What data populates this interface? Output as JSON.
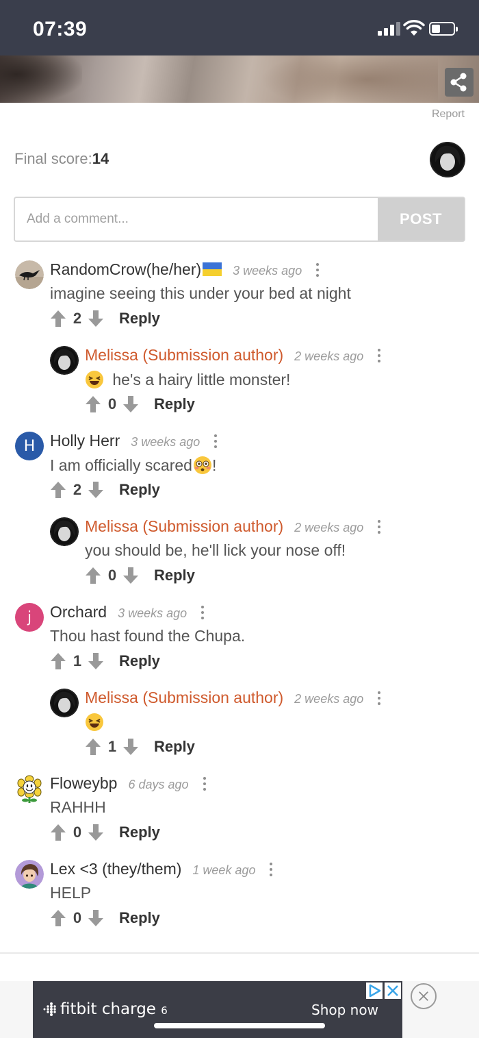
{
  "status_bar": {
    "time": "07:39"
  },
  "post": {
    "report_label": "Report",
    "final_score_label": "Final score:",
    "final_score_value": "14",
    "comment_placeholder": "Add a comment...",
    "post_button_label": "POST"
  },
  "comments": [
    {
      "name": "RandomCrow(he/her)",
      "name_flag": "ukraine-flag-icon",
      "time": "3 weeks ago",
      "text": "imagine seeing this under your bed at night",
      "votes": "2",
      "reply_label": "Reply",
      "avatar": "crow-avatar-icon"
    },
    {
      "name": "Melissa (Submission author)",
      "time": "2 weeks ago",
      "emoji": "laughing-face-icon",
      "text": "he's a hairy little monster!",
      "votes": "0",
      "reply_label": "Reply",
      "is_author": true
    },
    {
      "name": "Holly Herr",
      "avatar_letter": "H",
      "avatar_color": "#2a5aa8",
      "time": "3 weeks ago",
      "text": "I am officially scared",
      "emoji_after": "flushed-face-icon",
      "text_suffix": "!",
      "votes": "2",
      "reply_label": "Reply"
    },
    {
      "name": "Melissa (Submission author)",
      "time": "2 weeks ago",
      "text": "you should be, he'll lick your nose off!",
      "votes": "0",
      "reply_label": "Reply",
      "is_author": true
    },
    {
      "name": "Orchard",
      "avatar_letter": "j",
      "avatar_color": "#d9457a",
      "time": "3 weeks ago",
      "text": "Thou hast found the Chupa.",
      "votes": "1",
      "reply_label": "Reply"
    },
    {
      "name": "Melissa (Submission author)",
      "time": "2 weeks ago",
      "emoji": "laughing-face-icon",
      "votes": "1",
      "reply_label": "Reply",
      "is_author": true
    },
    {
      "name": "Floweybp",
      "time": "6 days ago",
      "text": "RAHHH",
      "votes": "0",
      "reply_label": "Reply",
      "avatar": "flower-avatar-icon"
    },
    {
      "name": "Lex <3 (they/them)",
      "time": "1 week ago",
      "text": "HELP",
      "votes": "0",
      "reply_label": "Reply",
      "avatar": "character-avatar-icon"
    }
  ],
  "ad": {
    "brand": "fitbit charge",
    "brand_number": "6",
    "cta": "Shop now"
  },
  "colors": {
    "status_bar": "#3a3e4c",
    "author_name": "#cf5a2d",
    "post_button": "#d0d0d0"
  }
}
